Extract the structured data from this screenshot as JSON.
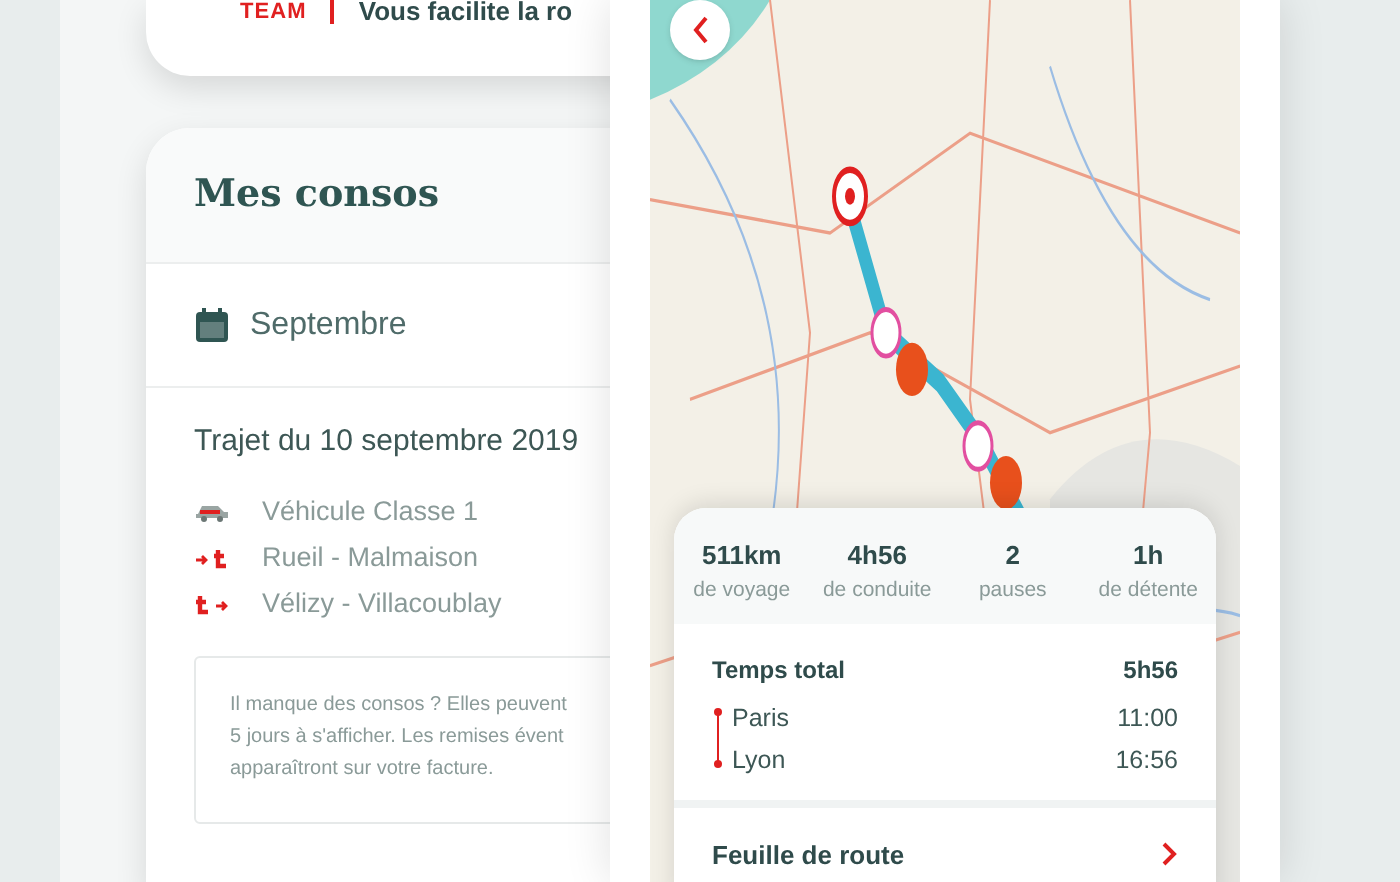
{
  "top_card": {
    "brand": "TEAM",
    "tagline": "Vous facilite la ro"
  },
  "consos": {
    "title": "Mes consos",
    "month": "Septembre",
    "trip_title": "Trajet du 10 septembre 2019",
    "details": [
      {
        "kind": "vehicle",
        "text": "Véhicule Classe 1"
      },
      {
        "kind": "entry",
        "text": "Rueil - Malmaison"
      },
      {
        "kind": "exit",
        "text": "Vélizy - Villacoublay"
      }
    ],
    "notice": [
      "Il manque des consos ? Elles peuvent",
      "5 jours à s'afficher. Les remises évent",
      "apparaîtront sur votre facture."
    ]
  },
  "trip": {
    "stats": [
      {
        "value": "511km",
        "label": "de voyage"
      },
      {
        "value": "4h56",
        "label": "de conduite"
      },
      {
        "value": "2",
        "label": "pauses"
      },
      {
        "value": "1h",
        "label": "de détente"
      }
    ],
    "total_label": "Temps total",
    "total_value": "5h56",
    "stops": [
      {
        "name": "Paris",
        "time": "11:00"
      },
      {
        "name": "Lyon",
        "time": "16:56"
      }
    ],
    "link": "Feuille de route"
  }
}
